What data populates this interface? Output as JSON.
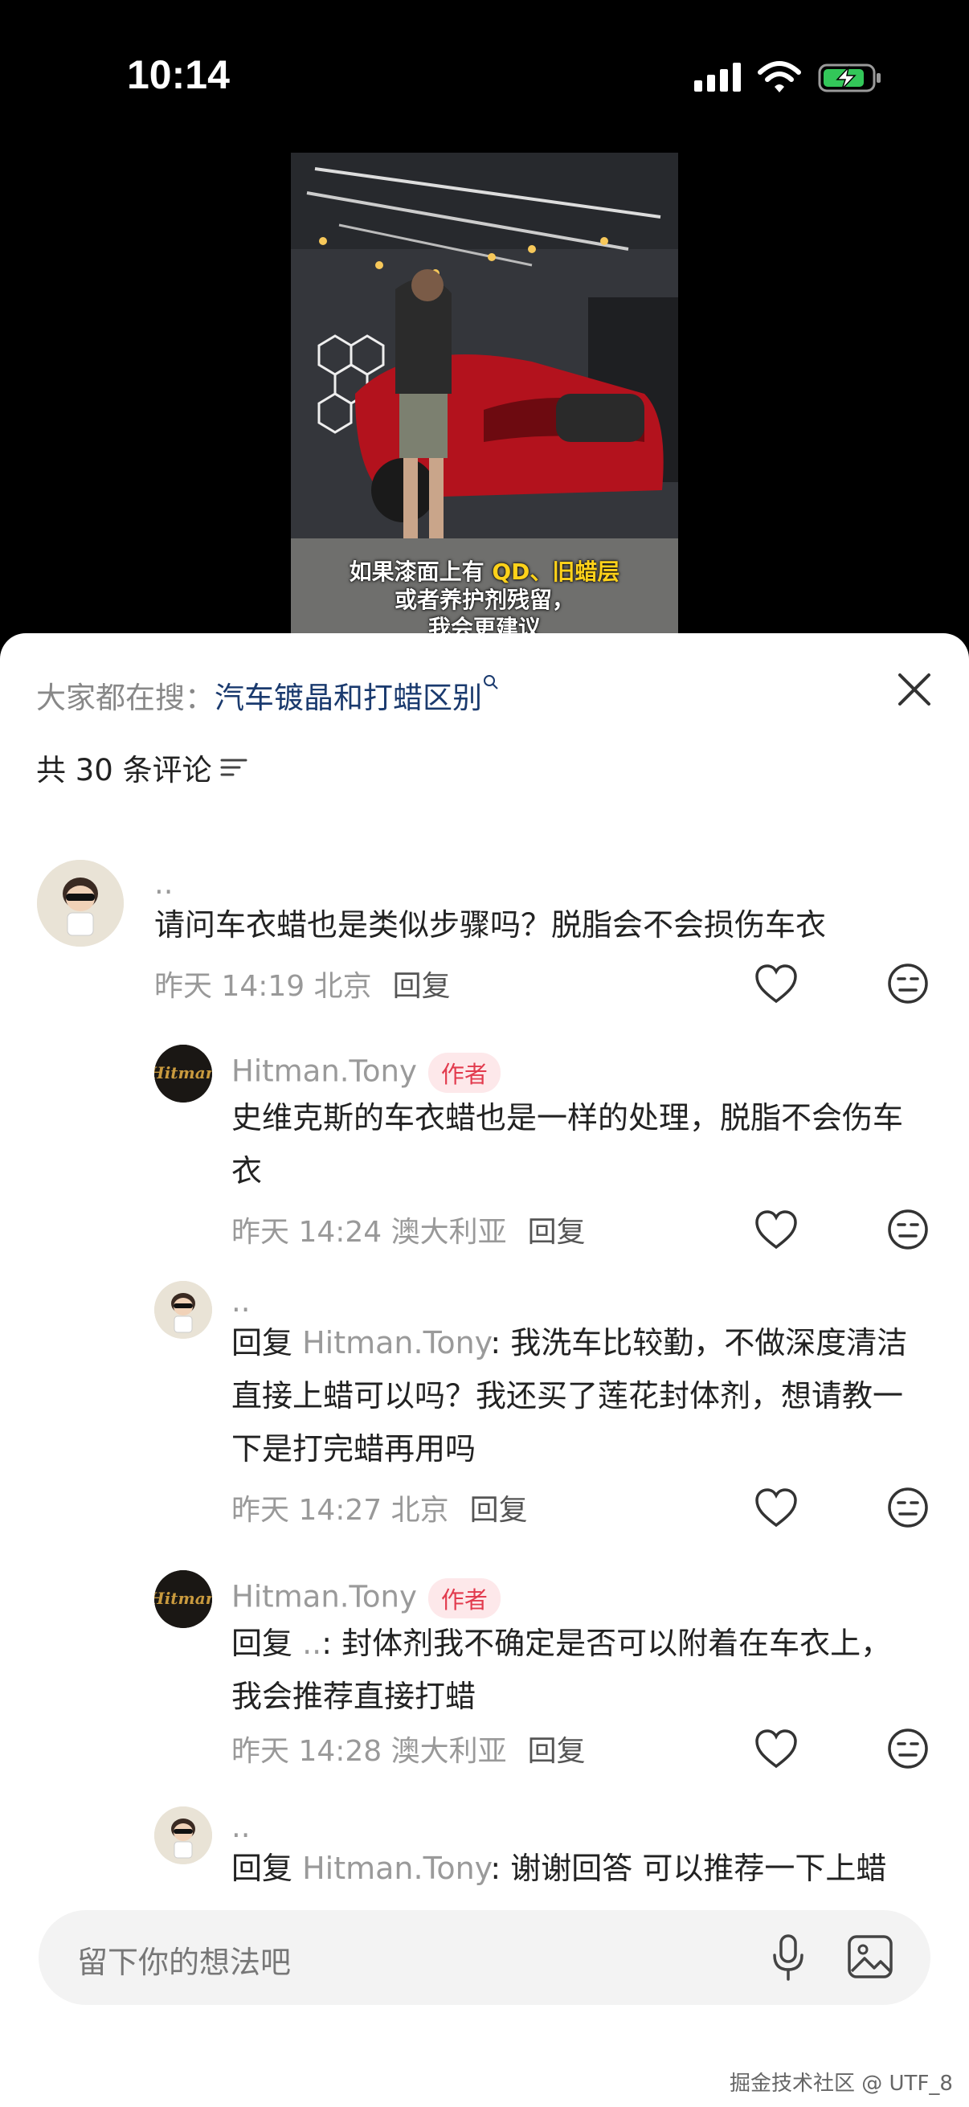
{
  "status_bar": {
    "time": "10:14"
  },
  "video": {
    "caption_line1_a": "如果漆面上有 ",
    "caption_line1_b": "QD、旧蜡层",
    "caption_line2": "或者养护剂残留，",
    "caption_line3": "我会更建议"
  },
  "sheet": {
    "search_prefix": "大家都在搜：",
    "search_term": "汽车镀晶和打蜡区别",
    "comment_count": "共 30 条评论"
  },
  "comments": [
    {
      "name": "..",
      "text": "请问车衣蜡也是类似步骤吗？脱脂会不会损伤车衣",
      "time": "昨天 14:19 北京",
      "reply": "回复"
    },
    {
      "name": "Hitman.Tony",
      "badge": "作者",
      "text": "史维克斯的车衣蜡也是一样的处理，脱脂不会伤车衣",
      "time": "昨天 14:24 澳大利亚",
      "reply": "回复"
    },
    {
      "name": "..",
      "reply_prefix": "回复 ",
      "reply_target": "Hitman.Tony",
      "text": ": 我洗车比较勤，不做深度清洁直接上蜡可以吗？我还买了莲花封体剂，想请教一下是打完蜡再用吗",
      "time": "昨天 14:27 北京",
      "reply": "回复"
    },
    {
      "name": "Hitman.Tony",
      "badge": "作者",
      "reply_prefix": "回复 ",
      "reply_target": "..",
      "text": ": 封体剂我不确定是否可以附着在车衣上，我会推荐直接打蜡",
      "time": "昨天 14:28 澳大利亚",
      "reply": "回复"
    },
    {
      "name": "..",
      "reply_prefix": "回复 ",
      "reply_target": "Hitman.Tony",
      "text": ": 谢谢回答 可以推荐一下上蜡"
    }
  ],
  "input": {
    "placeholder": "留下你的想法吧"
  },
  "watermark": "掘金技术社区 @ UTF_8",
  "colors": {
    "author_badge_text": "#e23b4e",
    "author_badge_bg": "#fde8ea",
    "search_link": "#1a3a6e"
  }
}
